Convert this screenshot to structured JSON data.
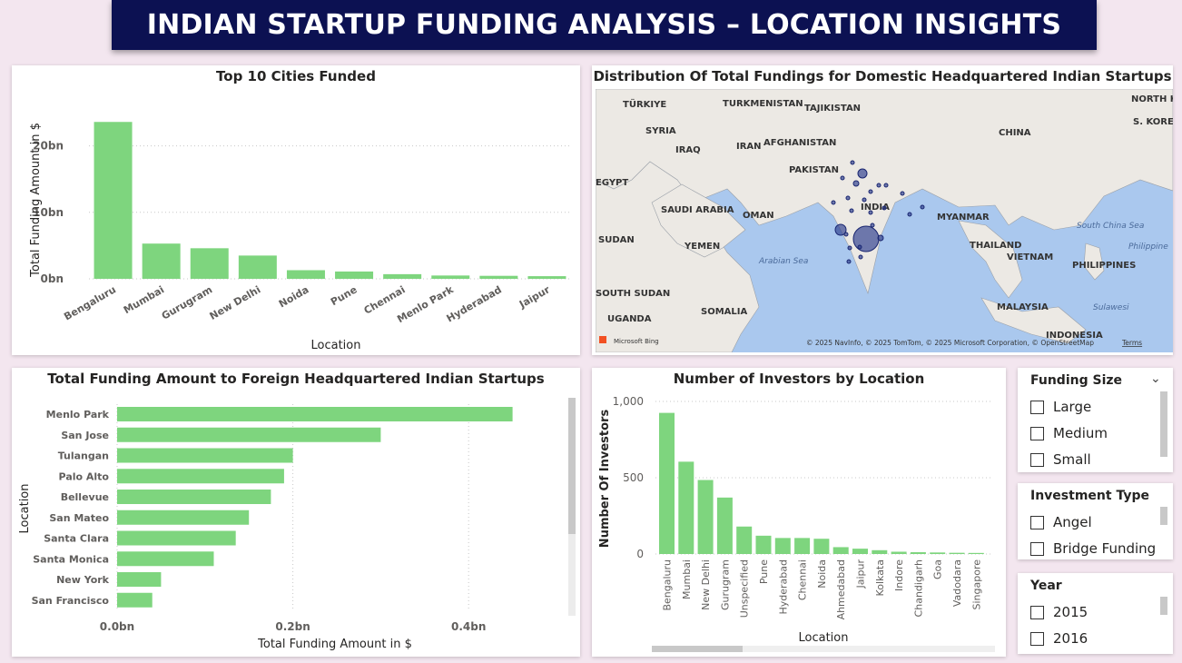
{
  "page_title": "INDIAN STARTUP FUNDING ANALYSIS – LOCATION INSIGHTS",
  "colors": {
    "bar": "#7ed57e",
    "title_bg": "#0c1152",
    "page_bg": "#f3e6ef",
    "map_bubble": "#2a3a8c"
  },
  "top_cities": {
    "title": "Top 10 Cities Funded",
    "xlabel": "Location",
    "ylabel": "Total Funding Amount in $",
    "yticks": [
      "0bn",
      "10bn",
      "20bn"
    ]
  },
  "map": {
    "title": "Distribution Of Total Fundings for Domestic Headquartered Indian Startups",
    "labels": [
      "NORTH KOREA",
      "TÜRKIYE",
      "TURKMENISTAN",
      "TAJIKISTAN",
      "S. KOREA",
      "SYRIA",
      "CHINA",
      "IRAQ",
      "IRAN",
      "AFGHANISTAN",
      "PAKISTAN",
      "EGYPT",
      "SAUDI ARABIA",
      "OMAN",
      "INDIA",
      "MYANMAR",
      "SUDAN",
      "YEMEN",
      "THAILAND",
      "VIETNAM",
      "PHILIPPINES",
      "SOUTH SUDAN",
      "SOMALIA",
      "UGANDA",
      "MALAYSIA",
      "INDONESIA",
      "Arabian Sea",
      "South China Sea",
      "Philippine",
      "Sulawesi"
    ],
    "attribution": "© 2025 NavInfo, © 2025 TomTom, © 2025 Microsoft Corporation, © OpenStreetMap",
    "terms": "Terms",
    "brand": "Microsoft Bing"
  },
  "foreign": {
    "title": "Total Funding Amount to Foreign Headquartered Indian Startups",
    "xlabel": "Total Funding Amount in $",
    "ylabel": "Location",
    "xticks": [
      "0.0bn",
      "0.2bn",
      "0.4bn"
    ]
  },
  "investors": {
    "title": "Number of Investors by Location",
    "xlabel": "Location",
    "ylabel": "Number Of Investors",
    "yticks": [
      "0",
      "500",
      "1,000"
    ]
  },
  "slicers": {
    "funding_size": {
      "title": "Funding Size",
      "options": [
        "Large",
        "Medium",
        "Small"
      ]
    },
    "investment_type": {
      "title": "Investment Type",
      "options": [
        "Angel",
        "Bridge Funding"
      ]
    },
    "year": {
      "title": "Year",
      "options": [
        "2015",
        "2016"
      ]
    }
  },
  "chart_data": [
    {
      "type": "bar",
      "title": "Top 10 Cities Funded",
      "xlabel": "Location",
      "ylabel": "Total Funding Amount in $",
      "categories": [
        "Bengaluru",
        "Mumbai",
        "Gurugram",
        "New Delhi",
        "Noida",
        "Pune",
        "Chennai",
        "Menlo Park",
        "Hyderabad",
        "Jaipur"
      ],
      "values": [
        23.6,
        5.3,
        4.6,
        3.5,
        1.3,
        1.1,
        0.7,
        0.5,
        0.45,
        0.4
      ],
      "unit": "bn",
      "ylim": [
        0,
        25
      ],
      "grid": true
    },
    {
      "type": "bar",
      "orientation": "horizontal",
      "title": "Total Funding Amount to Foreign Headquartered Indian Startups",
      "xlabel": "Total Funding Amount in $",
      "ylabel": "Location",
      "categories": [
        "Menlo Park",
        "San Jose",
        "Tulangan",
        "Palo Alto",
        "Bellevue",
        "San Mateo",
        "Santa Clara",
        "Santa Monica",
        "New York",
        "San Francisco"
      ],
      "values": [
        0.45,
        0.3,
        0.2,
        0.19,
        0.175,
        0.15,
        0.135,
        0.11,
        0.05,
        0.04
      ],
      "unit": "bn",
      "xlim": [
        0,
        0.5
      ],
      "grid": true
    },
    {
      "type": "bar",
      "title": "Number of Investors by Location",
      "xlabel": "Location",
      "ylabel": "Number Of Investors",
      "categories": [
        "Bengaluru",
        "Mumbai",
        "New Delhi",
        "Gurugram",
        "Unspecified",
        "Pune",
        "Hyderabad",
        "Chennai",
        "Noida",
        "Ahmedabad",
        "Jaipur",
        "Kolkata",
        "Indore",
        "Chandigarh",
        "Goa",
        "Vadodara",
        "Singapore"
      ],
      "values": [
        925,
        605,
        485,
        370,
        180,
        120,
        105,
        105,
        100,
        45,
        35,
        25,
        15,
        12,
        10,
        8,
        7
      ],
      "ylim": [
        0,
        1000
      ],
      "grid": true
    }
  ]
}
